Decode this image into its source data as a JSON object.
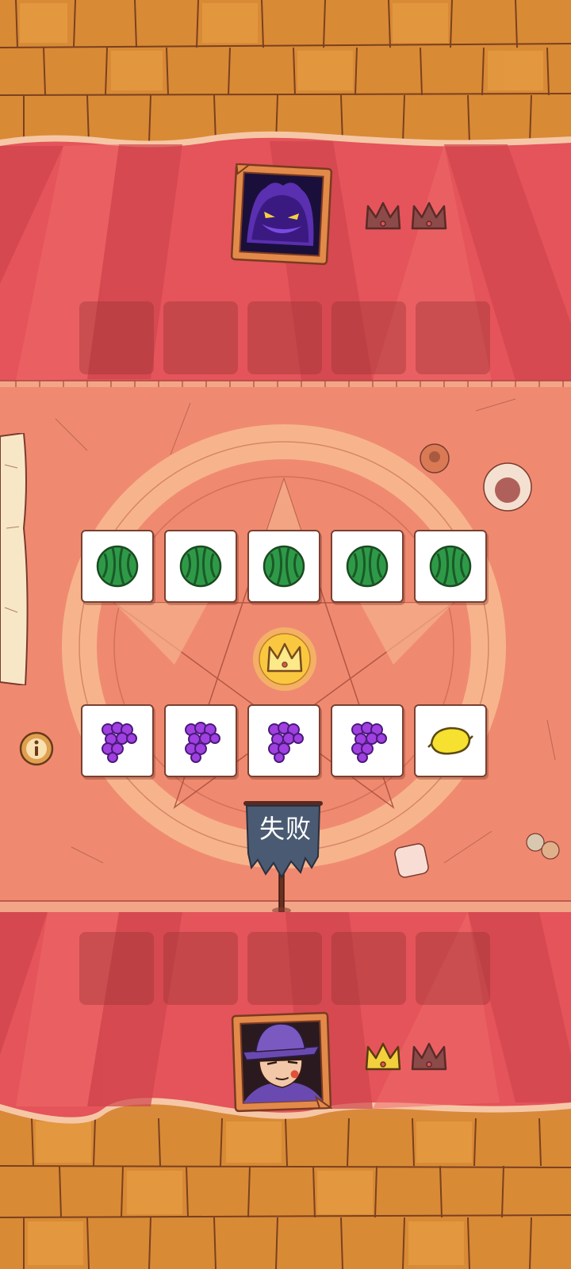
{
  "opponent": {
    "avatar": "shadow-demon-portrait",
    "crowns_won": 0,
    "crowns_total": 2
  },
  "player": {
    "avatar": "purple-hat-man-portrait",
    "crowns_won": 1,
    "crowns_total": 2
  },
  "board": {
    "opponent_cards": [
      "watermelon",
      "watermelon",
      "watermelon",
      "watermelon",
      "watermelon"
    ],
    "player_cards": [
      "grapes",
      "grapes",
      "grapes",
      "grapes",
      "lemon"
    ],
    "center_icon": "crown-icon"
  },
  "result": {
    "label": "失败"
  },
  "colors": {
    "band_red": "#e4545a",
    "arena": "#ef8a70",
    "wood": "#d98a35",
    "crown_gold": "#f2cf3c",
    "crown_empty": "#8c4a48",
    "banner": "#4a5a72"
  }
}
